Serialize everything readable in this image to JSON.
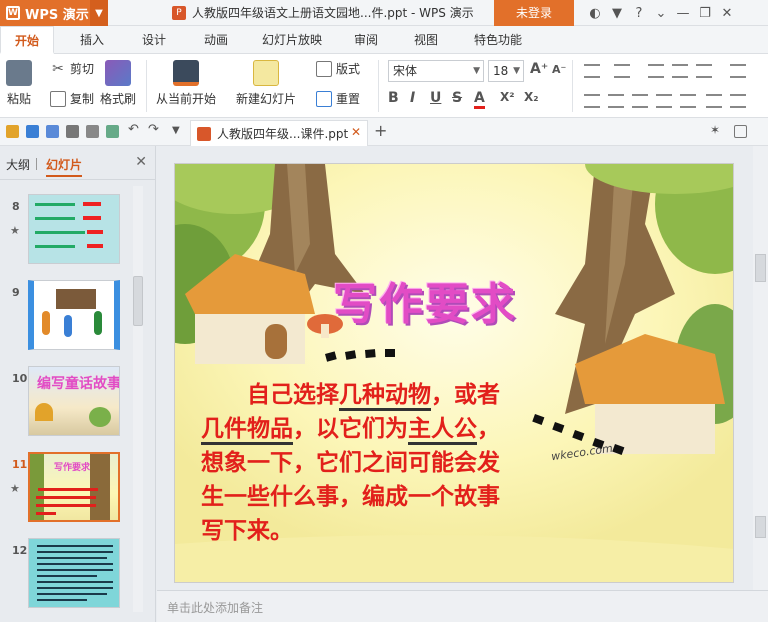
{
  "titlebar": {
    "app_name": "WPS 演示",
    "document_title": "人教版四年级语文上册语文园地...件.ppt - WPS 演示",
    "login_label": "未登录"
  },
  "menu": {
    "tabs": [
      "开始",
      "插入",
      "设计",
      "动画",
      "幻灯片放映",
      "审阅",
      "视图",
      "特色功能"
    ],
    "active": "开始"
  },
  "ribbon": {
    "paste": "粘贴",
    "cut": "剪切",
    "copy": "复制",
    "format_painter": "格式刷",
    "from_current": "从当前开始",
    "new_slide": "新建幻灯片",
    "layout": "版式",
    "reset": "重置",
    "font_name": "宋体",
    "font_size": "18",
    "bold": "B",
    "italic": "I",
    "underline": "U",
    "strike": "S",
    "font_color": "A",
    "superscript": "X²",
    "subscript": "X₂",
    "grow": "A⁺",
    "shrink": "A⁻"
  },
  "doc_tab": {
    "label": "人教版四年级...课件.ppt"
  },
  "left_panel": {
    "tab_outline": "大纲",
    "tab_slides": "幻灯片",
    "thumbnails": [
      {
        "num": "8",
        "starred": true,
        "active": false
      },
      {
        "num": "9",
        "starred": false,
        "active": false
      },
      {
        "num": "10",
        "starred": false,
        "active": false
      },
      {
        "num": "11",
        "starred": true,
        "active": true
      },
      {
        "num": "12",
        "starred": false,
        "active": false
      }
    ],
    "thumb10_title": "编写童话故事",
    "thumb11_title": "写作要求"
  },
  "slide": {
    "title": "写作要求",
    "body_lines": [
      "自己选择几种动物，或者",
      "几件物品，以它们为主人公，",
      "想象一下，它们之间可能会发",
      "生一些什么事，编成一个故事",
      "写下来。"
    ],
    "watermark": "wkeco.com"
  },
  "notes": {
    "placeholder": "单击此处添加备注"
  },
  "colors": {
    "accent": "#e2702a",
    "title_pink": "#e24cc5",
    "body_red": "#e2201b"
  }
}
